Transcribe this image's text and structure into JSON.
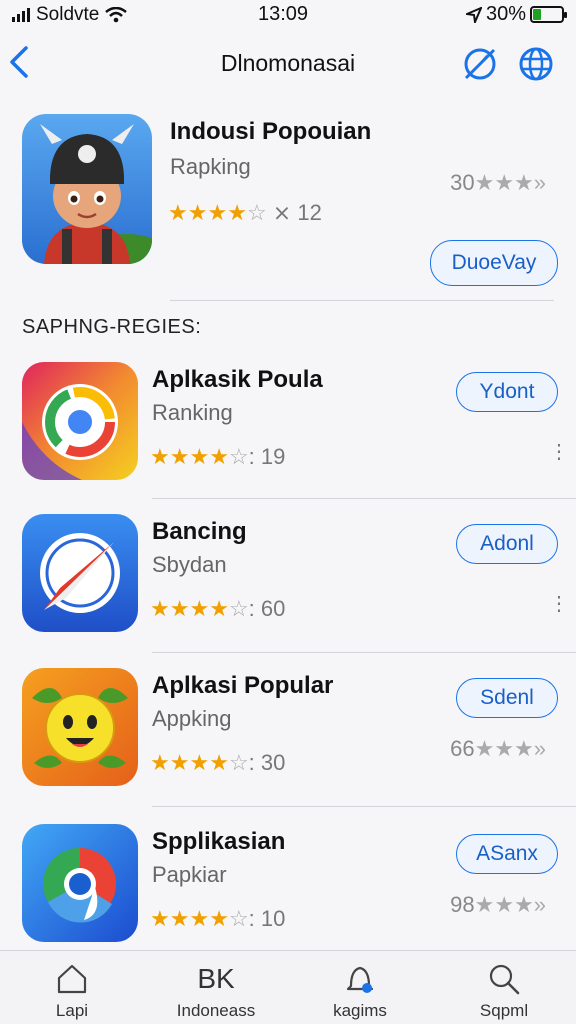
{
  "status": {
    "carrier": "Soldvte",
    "time": "13:09",
    "battery": "30%",
    "battery_level": 0.3,
    "battery_color": "#1fa21f"
  },
  "nav": {
    "back_icon": "chevron-left-icon",
    "title": "Dlnomonasai",
    "icons": [
      "compass-slash-icon",
      "globe-icon"
    ]
  },
  "featured": {
    "name": "Indousi Popouian",
    "subtitle": "Rapking",
    "stars": 4,
    "rating_count": "12",
    "rank": "30",
    "button": "DuoeVay"
  },
  "section_title": "SAPHNG-REGIES:",
  "apps": [
    {
      "name": "Aplkasik Poula",
      "subtitle": "Ranking",
      "stars": 4,
      "rating_count": "19",
      "button": "Ydont",
      "rank": null,
      "more": true
    },
    {
      "name": "Bancing",
      "subtitle": "Sbydan",
      "stars": 4,
      "rating_count": "60",
      "button": "Adonl",
      "rank": null,
      "more": true
    },
    {
      "name": "Aplkasi Popular",
      "subtitle": "Appking",
      "stars": 4,
      "rating_count": "30",
      "button": "Sdenl",
      "rank": "66",
      "more": false
    },
    {
      "name": "Spplikasian",
      "subtitle": "Papkiar",
      "stars": 4,
      "rating_count": "10",
      "button": "ASanx",
      "rank": "98",
      "more": false
    }
  ],
  "tabs": [
    {
      "label": "Lapi",
      "icon": "home-icon"
    },
    {
      "label": "Indoneass",
      "icon": "bk-icon",
      "glyph": "BK"
    },
    {
      "label": "kagims",
      "icon": "bell-icon"
    },
    {
      "label": "Sqpml",
      "icon": "search-icon"
    }
  ],
  "colors": {
    "accent": "#1a73e8",
    "star": "#f0a000"
  }
}
